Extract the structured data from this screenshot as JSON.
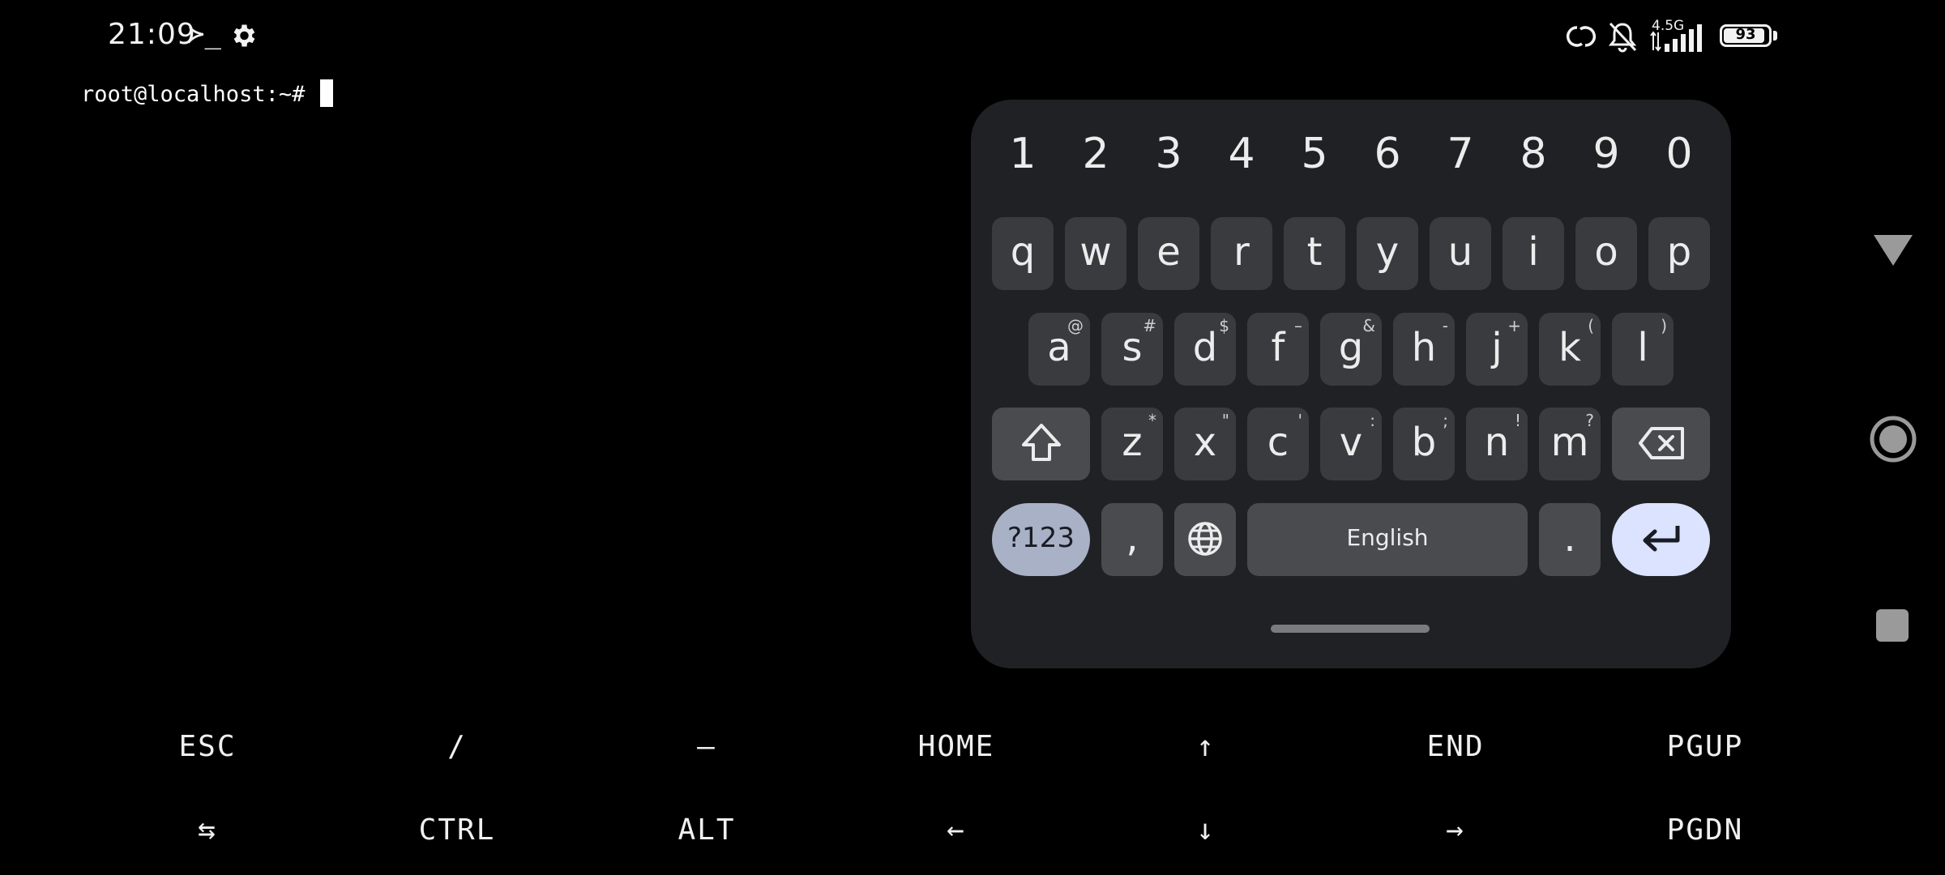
{
  "status_bar": {
    "time": "21:09",
    "terminal_glyph": "≻_",
    "network": "4.5G",
    "battery": "93",
    "battery_level_percent": 93
  },
  "terminal": {
    "prompt": "root@localhost:~# "
  },
  "keyboard": {
    "number_row": [
      "1",
      "2",
      "3",
      "4",
      "5",
      "6",
      "7",
      "8",
      "9",
      "0"
    ],
    "row1": [
      {
        "key": "q"
      },
      {
        "key": "w"
      },
      {
        "key": "e"
      },
      {
        "key": "r"
      },
      {
        "key": "t"
      },
      {
        "key": "y"
      },
      {
        "key": "u"
      },
      {
        "key": "i"
      },
      {
        "key": "o"
      },
      {
        "key": "p"
      }
    ],
    "row2": [
      {
        "key": "a",
        "hint": "@"
      },
      {
        "key": "s",
        "hint": "#"
      },
      {
        "key": "d",
        "hint": "$"
      },
      {
        "key": "f",
        "hint": "–"
      },
      {
        "key": "g",
        "hint": "&"
      },
      {
        "key": "h",
        "hint": "-"
      },
      {
        "key": "j",
        "hint": "+"
      },
      {
        "key": "k",
        "hint": "("
      },
      {
        "key": "l",
        "hint": ")"
      }
    ],
    "row3": [
      {
        "key": "z",
        "hint": "*"
      },
      {
        "key": "x",
        "hint": "\""
      },
      {
        "key": "c",
        "hint": "'"
      },
      {
        "key": "v",
        "hint": ":"
      },
      {
        "key": "b",
        "hint": ";"
      },
      {
        "key": "n",
        "hint": "!"
      },
      {
        "key": "m",
        "hint": "?"
      }
    ],
    "symbols_label": "?123",
    "comma": ",",
    "space_label": "English",
    "period": "."
  },
  "extra_keys": {
    "row1": [
      "ESC",
      "/",
      "—",
      "HOME",
      "↑",
      "END",
      "PGUP"
    ],
    "row2": [
      "⇆",
      "CTRL",
      "ALT",
      "←",
      "↓",
      "→",
      "PGDN"
    ]
  },
  "colors": {
    "keyboard_bg": "#202124",
    "key_bg": "#3a3b3e",
    "symbols_key_bg": "#a9b1c7",
    "enter_key_bg": "#dbe3ff"
  }
}
